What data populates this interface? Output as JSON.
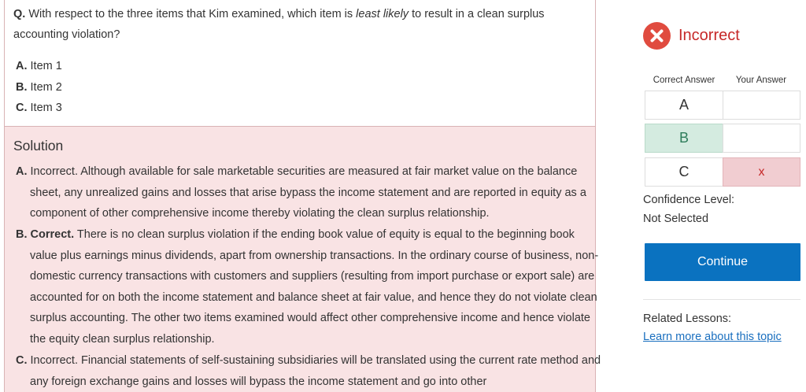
{
  "question": {
    "prefix": "Q.",
    "text_before": "With respect to the three items that Kim examined, which item is ",
    "emphasis": "least likely",
    "text_after": " to result in a clean surplus accounting violation?",
    "choices": [
      {
        "letter": "A.",
        "text": "Item 1"
      },
      {
        "letter": "B.",
        "text": "Item 2"
      },
      {
        "letter": "C.",
        "text": "Item 3"
      }
    ]
  },
  "solution": {
    "title": "Solution",
    "items": [
      {
        "letter": "A.",
        "verdict": "",
        "text": "Incorrect. Although available for sale marketable securities are measured at fair market value on the balance sheet, any unrealized gains and losses that arise bypass the income statement and are reported in equity as a component of other comprehensive income thereby violating the clean surplus relationship."
      },
      {
        "letter": "B.",
        "verdict": "Correct.",
        "text": " There is no clean surplus violation if the ending book value of equity is equal to the beginning book value plus earnings minus dividends, apart from ownership transactions. In the ordinary course of business, non-domestic currency transactions with customers and suppliers (resulting from import purchase or export sale) are accounted for on both the income statement and balance sheet at fair value, and hence they do not violate clean surplus accounting. The other two items examined would affect other comprehensive income and hence violate the equity clean surplus relationship."
      },
      {
        "letter": "C.",
        "verdict": "",
        "text": "Incorrect. Financial statements of self-sustaining subsidiaries will be translated using the current rate method and any foreign exchange gains and losses will bypass the income statement and go into other"
      }
    ]
  },
  "result": {
    "status": "Incorrect",
    "status_icon": "close-circle-icon",
    "status_color": "#e04b3f"
  },
  "answers": {
    "correct_header": "Correct Answer",
    "yours_header": "Your Answer",
    "rows": [
      {
        "option": "A",
        "your_mark": ""
      },
      {
        "option": "B",
        "your_mark": ""
      },
      {
        "option": "C",
        "your_mark": "x"
      }
    ],
    "correct_color": "#d4ebe0",
    "wrong_color": "#f1cdd1"
  },
  "confidence": {
    "label": "Confidence Level:",
    "value": "Not Selected"
  },
  "continue_label": "Continue",
  "accent_color": "#0a72c0",
  "related": {
    "label": "Related Lessons:",
    "link": "Learn more about this topic"
  }
}
